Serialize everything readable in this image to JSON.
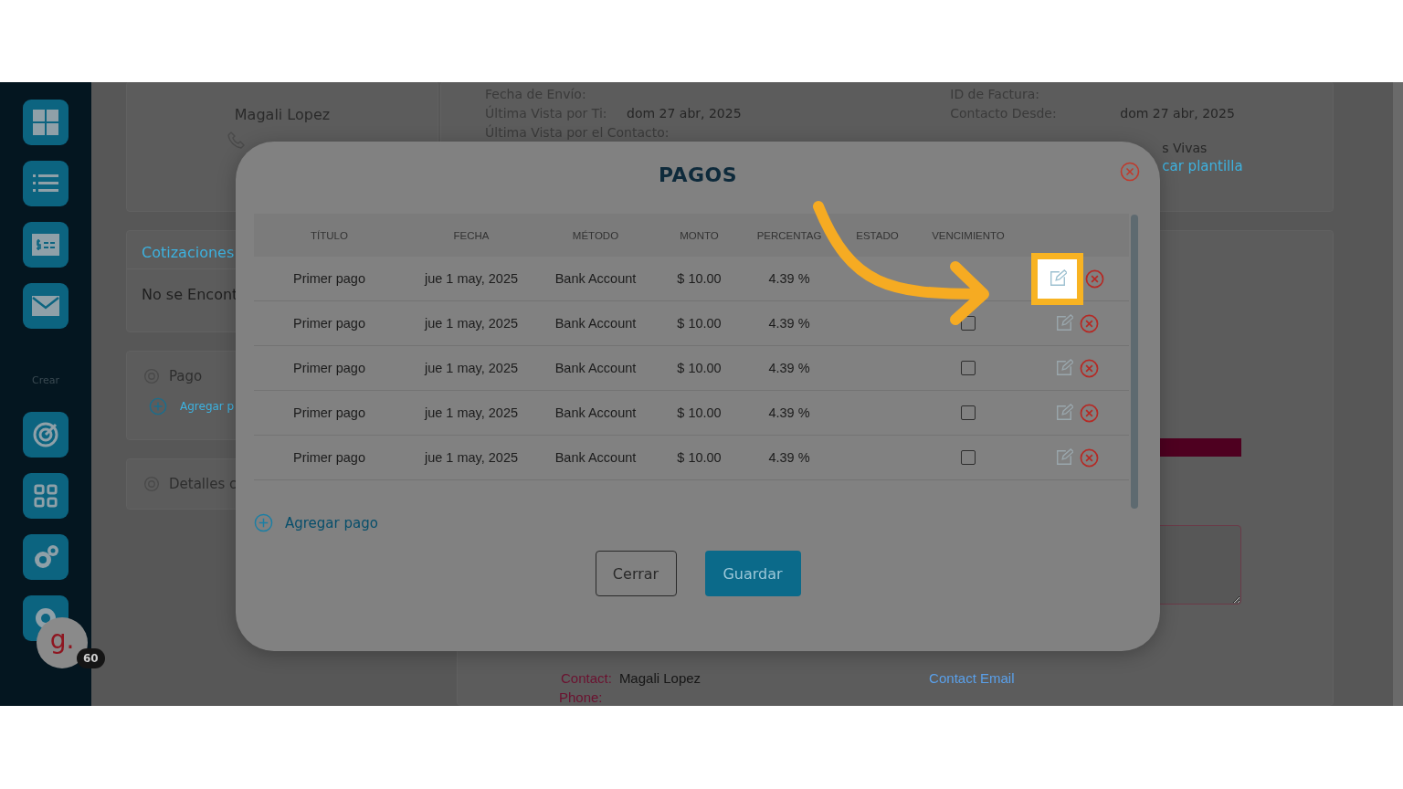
{
  "sidebar": {
    "section_label": "Crear",
    "avatar": {
      "logo": "g.",
      "badge": "60"
    }
  },
  "contact_card": {
    "name": "Magali Lopez"
  },
  "quotes_card": {
    "title": "Cotizaciones",
    "empty_text": "No se Encont"
  },
  "payment_card": {
    "title": "Pago",
    "link": "Agregar p"
  },
  "details_card": {
    "title": "Detalles c"
  },
  "invoice_info": {
    "left": [
      {
        "label": "Fecha de Envío:"
      },
      {
        "label": "Última Vista por Ti:",
        "value": "dom 27 abr, 2025"
      },
      {
        "label": "Última Vista por el Contacto:"
      }
    ],
    "right": [
      {
        "label": "ID de Factura:"
      },
      {
        "label": "Contacto Desde:",
        "value": "dom 27 abr, 2025"
      }
    ],
    "status_text": "s Vivas",
    "template_link": "car plantilla"
  },
  "contact_section": {
    "contact_label": "Contact:",
    "contact_value": "Magali Lopez",
    "email_link": "Contact Email",
    "phone_label": "Phone:"
  },
  "modal": {
    "title": "PAGOS",
    "columns": [
      "TÍTULO",
      "FECHA",
      "MÉTODO",
      "MONTO",
      "PERCENTAG",
      "ESTADO",
      "VENCIMIENTO"
    ],
    "rows": [
      {
        "titulo": "Primer pago",
        "fecha": "jue 1 may, 2025",
        "metodo": "Bank Account",
        "monto": "$ 10.00",
        "porcentaje": "4.39 %",
        "highlighted": true
      },
      {
        "titulo": "Primer pago",
        "fecha": "jue 1 may, 2025",
        "metodo": "Bank Account",
        "monto": "$ 10.00",
        "porcentaje": "4.39 %",
        "checked": false,
        "highlighted": false
      },
      {
        "titulo": "Primer pago",
        "fecha": "jue 1 may, 2025",
        "metodo": "Bank Account",
        "monto": "$ 10.00",
        "porcentaje": "4.39 %",
        "checked": false,
        "highlighted": false
      },
      {
        "titulo": "Primer pago",
        "fecha": "jue 1 may, 2025",
        "metodo": "Bank Account",
        "monto": "$ 10.00",
        "porcentaje": "4.39 %",
        "checked": false,
        "highlighted": false
      },
      {
        "titulo": "Primer pago",
        "fecha": "jue 1 may, 2025",
        "metodo": "Bank Account",
        "monto": "$ 10.00",
        "porcentaje": "4.39 %",
        "checked": false,
        "highlighted": false
      }
    ],
    "add_link": "Agregar pago",
    "buttons": [
      {
        "label": "Cerrar",
        "kind": "secondary"
      },
      {
        "label": "Guardar",
        "kind": "primary"
      }
    ]
  }
}
